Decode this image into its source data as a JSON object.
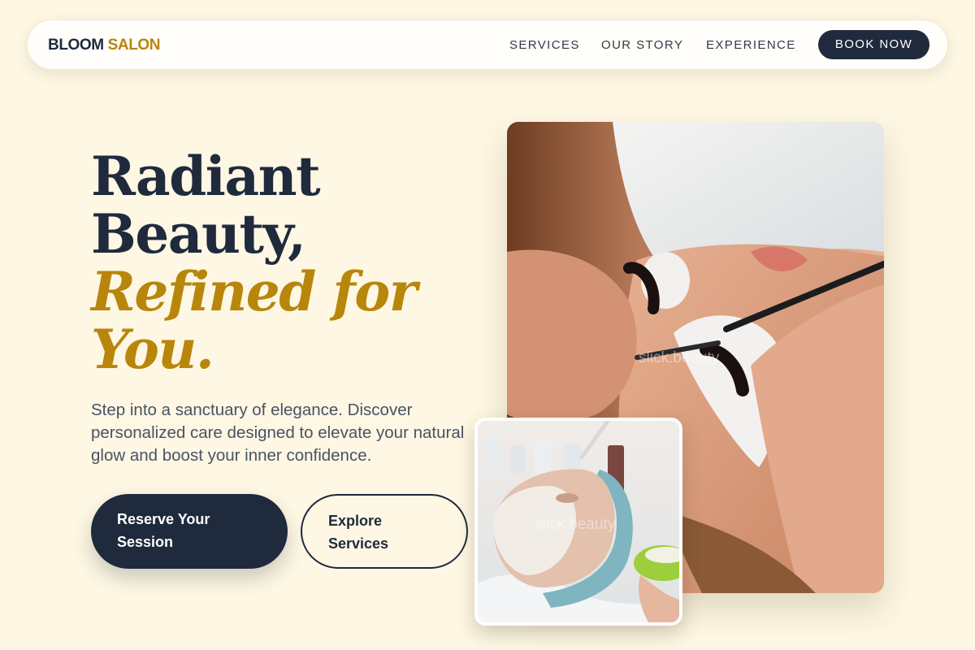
{
  "brand": {
    "part1": "BLOOM",
    "part2": "SALON"
  },
  "nav": {
    "links": [
      "SERVICES",
      "OUR STORY",
      "EXPERIENCE"
    ],
    "cta": "BOOK NOW"
  },
  "hero": {
    "title_line1": "Radiant",
    "title_line2": "Beauty,",
    "title_line3": "Refined for",
    "title_line4": "You.",
    "lead": "Step into a sanctuary of elegance. Discover personalized care designed to elevate your natural glow and boost your inner confidence.",
    "primary_button": "Reserve Your Session",
    "secondary_button": "Explore Services"
  },
  "images": {
    "watermark": "slick.beauty"
  },
  "colors": {
    "background": "#fdf7e3",
    "navy": "#1f2a3d",
    "gold": "#b8860b"
  }
}
